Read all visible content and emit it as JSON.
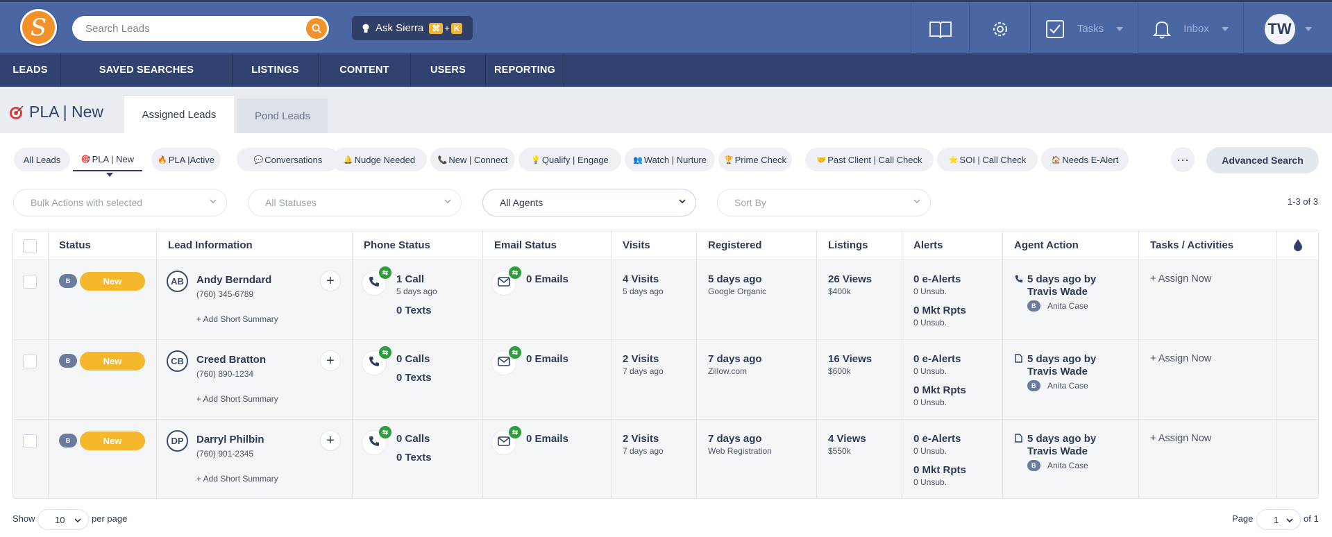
{
  "app": {
    "logo_letter": "S"
  },
  "search": {
    "placeholder": "Search Leads"
  },
  "ask": {
    "label": "Ask Sierra",
    "key1": "⌘",
    "plus": "+",
    "key2": "K"
  },
  "topbar": {
    "tasks_label": "Tasks",
    "inbox_label": "Inbox",
    "user_initials": "TW"
  },
  "nav": {
    "items": [
      "LEADS",
      "SAVED SEARCHES",
      "LISTINGS",
      "CONTENT",
      "USERS",
      "REPORTING"
    ]
  },
  "page": {
    "title": "PLA | New",
    "tabs": [
      "Assigned Leads",
      "Pond Leads"
    ]
  },
  "filters": {
    "chips": [
      "All Leads",
      "PLA | New",
      "Active",
      "Conversations",
      "Nudge Needed",
      "New | Connect",
      "Qualify | Engage",
      "Watch | Nurture",
      "Prime Check",
      "Past Client | Call Check",
      "SOI | Call Check",
      "Needs E-Alert"
    ],
    "chip_icons": [
      "",
      "🎯",
      "🔥",
      "💬",
      "🔔",
      "📞",
      "💡",
      "👥",
      "🏆",
      "🤝",
      "⭐",
      "🏠"
    ],
    "chip_prefix": [
      "",
      "",
      "PLA | ",
      "",
      "",
      "",
      "",
      "",
      "",
      "",
      "",
      ""
    ],
    "more_label": "···",
    "advanced_label": "Advanced Search",
    "bulk_label": "Bulk Actions with selected",
    "status_label": "All Statuses",
    "agents_label": "All Agents",
    "sort_label": "Sort By",
    "count": "1-3 of 3"
  },
  "table": {
    "headers": [
      "Status",
      "Lead Information",
      "Phone Status",
      "Email Status",
      "Visits",
      "Registered",
      "Listings",
      "Alerts",
      "Agent Action",
      "Tasks / Activities"
    ],
    "rows": [
      {
        "badge": "B",
        "status": "New",
        "initials": "AB",
        "name": "Andy Berndard",
        "phone": "(760) 345-6789",
        "summary": "+ Add Short Summary",
        "calls": "1 Call",
        "calls_sub": "5 days ago",
        "texts": "0 Texts",
        "emails": "0 Emails",
        "visits": "4 Visits",
        "visits_sub": "5 days ago",
        "registered": "5 days ago",
        "source": "Google Organic",
        "views": "26 Views",
        "price": "$400k",
        "ealerts": "0 e-Alerts",
        "ealerts_sub": "0 Unsub.",
        "mkt": "0 Mkt Rpts",
        "mkt_sub": "0 Unsub.",
        "action_icon": "phone",
        "action1": "5 days ago by",
        "action2": "Travis Wade",
        "agent_badge": "B",
        "agent": "Anita Case",
        "task": "+ Assign Now"
      },
      {
        "badge": "B",
        "status": "New",
        "initials": "CB",
        "name": "Creed Bratton",
        "phone": "(760) 890-1234",
        "summary": "+ Add Short Summary",
        "calls": "0 Calls",
        "calls_sub": "",
        "texts": "0 Texts",
        "emails": "0 Emails",
        "visits": "2 Visits",
        "visits_sub": "7 days ago",
        "registered": "7 days ago",
        "source": "Zillow.com",
        "views": "16 Views",
        "price": "$600k",
        "ealerts": "0 e-Alerts",
        "ealerts_sub": "0 Unsub.",
        "mkt": "0 Mkt Rpts",
        "mkt_sub": "0 Unsub.",
        "action_icon": "doc",
        "action1": "5 days ago by",
        "action2": "Travis Wade",
        "agent_badge": "B",
        "agent": "Anita Case",
        "task": "+ Assign Now"
      },
      {
        "badge": "B",
        "status": "New",
        "initials": "DP",
        "name": "Darryl Philbin",
        "phone": "(760) 901-2345",
        "summary": "+ Add Short Summary",
        "calls": "0 Calls",
        "calls_sub": "",
        "texts": "0 Texts",
        "emails": "0 Emails",
        "visits": "2 Visits",
        "visits_sub": "7 days ago",
        "registered": "7 days ago",
        "source": "Web Registration",
        "views": "4 Views",
        "price": "$550k",
        "ealerts": "0 e-Alerts",
        "ealerts_sub": "0 Unsub.",
        "mkt": "0 Mkt Rpts",
        "mkt_sub": "0 Unsub.",
        "action_icon": "doc",
        "action1": "5 days ago by",
        "action2": "Travis Wade",
        "agent_badge": "B",
        "agent": "Anita Case",
        "task": "+ Assign Now"
      }
    ]
  },
  "footer": {
    "show_label": "Show",
    "per_page_value": "10",
    "per_page_label": "per page",
    "page_label": "Page",
    "page_value": "1",
    "of_label": "of 1"
  },
  "colors": {
    "header_bg": "#4a67a4",
    "nav_bg": "#2f4270",
    "accent_orange": "#f3922b",
    "status_new": "#f5b72b",
    "online_green": "#2e9e3d"
  }
}
